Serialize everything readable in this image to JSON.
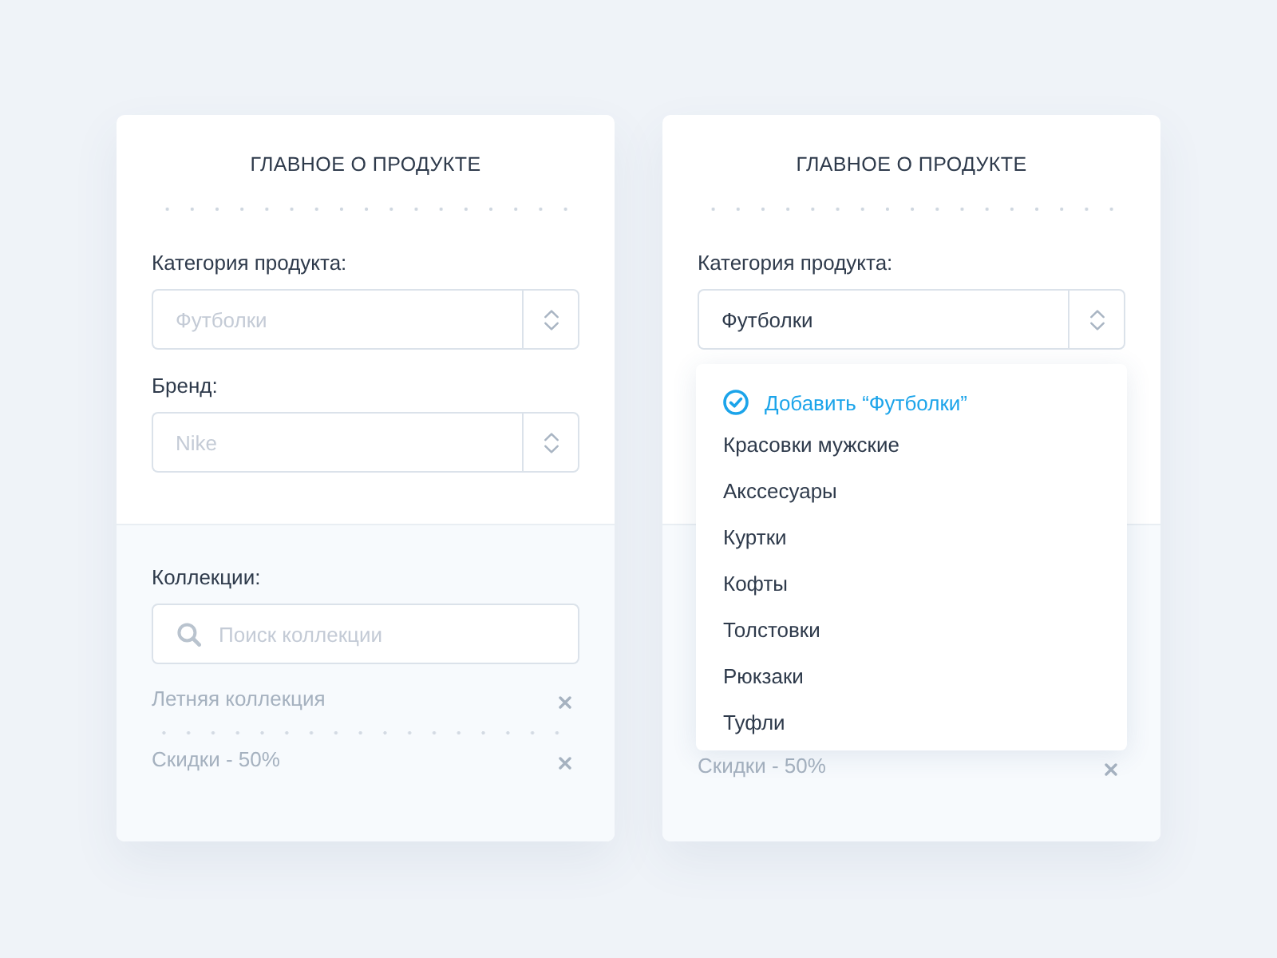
{
  "cards": [
    {
      "title": "ГЛАВНОЕ О ПРОДУКТЕ",
      "fields": [
        {
          "label": "Категория продукта:",
          "placeholder": "Футболки"
        },
        {
          "label": "Бренд:",
          "placeholder": "Nike"
        }
      ],
      "collections": {
        "label": "Коллекции:",
        "search": {
          "placeholder": "Поиск коллекции"
        },
        "items": [
          "Летняя коллекция",
          "Скидки - 50%"
        ]
      }
    },
    {
      "title": "ГЛАВНОЕ О ПРОДУКТЕ",
      "fields": [
        {
          "label": "Категория продукта:",
          "value": "Футболки"
        }
      ],
      "dropdown": {
        "options": [
          {
            "kind": "add",
            "label": "Добавить “Футболки”"
          },
          {
            "kind": "option",
            "label": "Красовки мужские"
          },
          {
            "kind": "option",
            "label": "Акссесуары"
          },
          {
            "kind": "option",
            "label": "Куртки"
          },
          {
            "kind": "option",
            "label": "Кофты"
          },
          {
            "kind": "option",
            "label": "Толстовки"
          },
          {
            "kind": "option",
            "label": "Рюкзаки"
          },
          {
            "kind": "option",
            "label": "Туфли"
          }
        ]
      },
      "collections": {
        "items": [
          "Скидки - 50%"
        ]
      }
    }
  ]
}
